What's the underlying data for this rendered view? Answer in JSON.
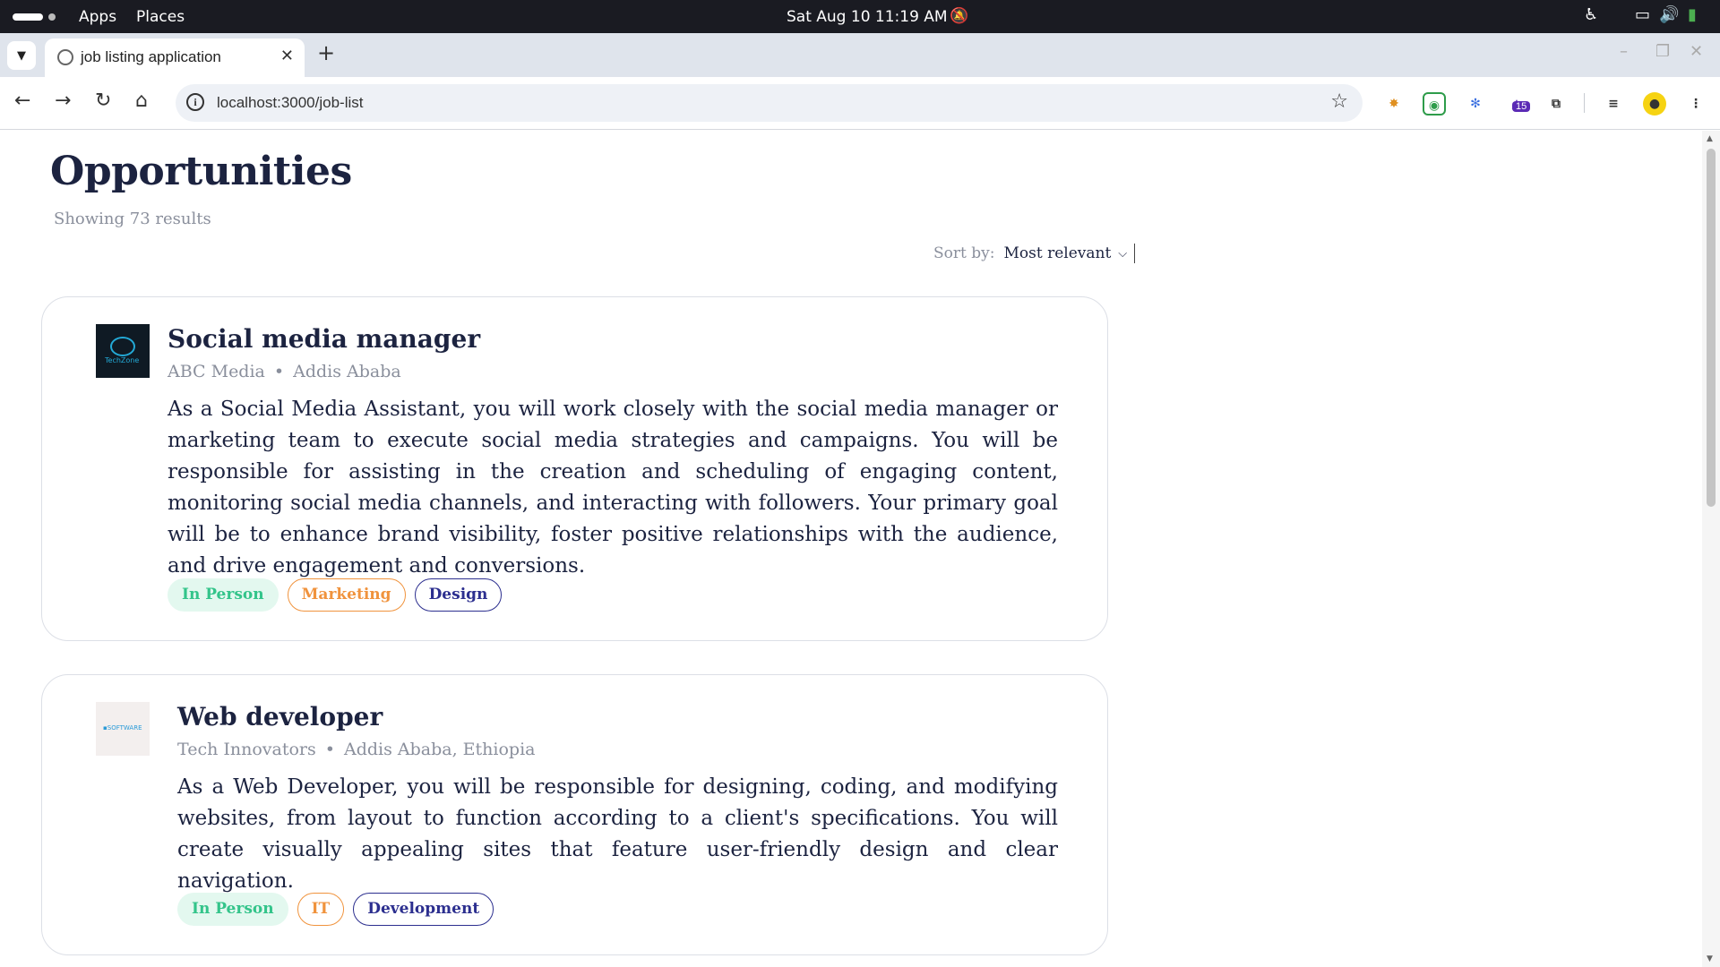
{
  "topbar": {
    "apps_label": "Apps",
    "places_label": "Places",
    "clock": "Sat Aug 10  11:19 AM"
  },
  "browser": {
    "tab_title": "job listing application",
    "url": "localhost:3000/job-list",
    "extension_badge": "15"
  },
  "page": {
    "title": "Opportunities",
    "result_count": "Showing 73 results",
    "sort_label": "Sort by:",
    "sort_value": "Most relevant"
  },
  "jobs": [
    {
      "title": "Social media manager",
      "company": "ABC Media",
      "location": "Addis Ababa",
      "description": "As a Social Media Assistant, you will work closely with the social media manager or marketing team to execute social media strategies and campaigns. You will be responsible for assisting in the creation and scheduling of engaging content, monitoring social media channels, and interacting with followers. Your primary goal will be to enhance brand visibility, foster positive relationships with the audience, and drive engagement and conversions.",
      "tags": [
        "In Person",
        "Marketing",
        "Design"
      ]
    },
    {
      "title": "Web developer",
      "company": "Tech Innovators",
      "location": "Addis Ababa, Ethiopia",
      "description": "As a Web Developer, you will be responsible for designing, coding, and modifying websites, from layout to function according to a client's specifications. You will create visually appealing sites that feature user-friendly design and clear navigation.",
      "tags": [
        "In Person",
        "IT",
        "Development"
      ]
    }
  ],
  "colors": {
    "heading": "#1c2340",
    "muted": "#8a8f9c",
    "tag_green": "#33c48a",
    "tag_orange": "#f0933d",
    "tag_blue": "#2c2f8f"
  }
}
